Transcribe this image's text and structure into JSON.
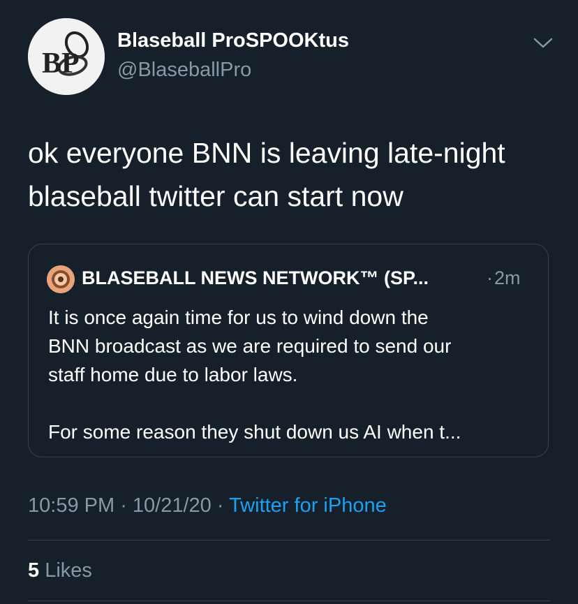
{
  "author": {
    "avatar_initials": "BP",
    "display_name": "Blaseball ProSPOOKtus",
    "handle": "@BlaseballPro"
  },
  "tweet": {
    "text_lines": [
      "ok everyone BNN is leaving late-night",
      "blaseball twitter can start now"
    ]
  },
  "quoted_tweet": {
    "display_name": "BLASEBALL NEWS NETWORK™ (SP...",
    "separator": "·",
    "time_ago": "2m",
    "text_lines": [
      "It is once again time for us to wind down the",
      "BNN broadcast as we are required to send our",
      "staff home due to labor laws.",
      "",
      "For some reason they shut down us AI when t..."
    ]
  },
  "meta": {
    "time": "10:59 PM",
    "separator": " · ",
    "date": "10/21/20",
    "source": "Twitter for iPhone"
  },
  "stats": {
    "likes_count": "5",
    "likes_label": "Likes"
  },
  "colors": {
    "background": "#15202b",
    "text": "#ffffff",
    "secondary": "#8899a6",
    "link": "#1da1f2",
    "border": "#38444d"
  },
  "icons": {
    "menu": "chevron-down-icon",
    "quote_avatar": "bnn-logo-icon"
  }
}
